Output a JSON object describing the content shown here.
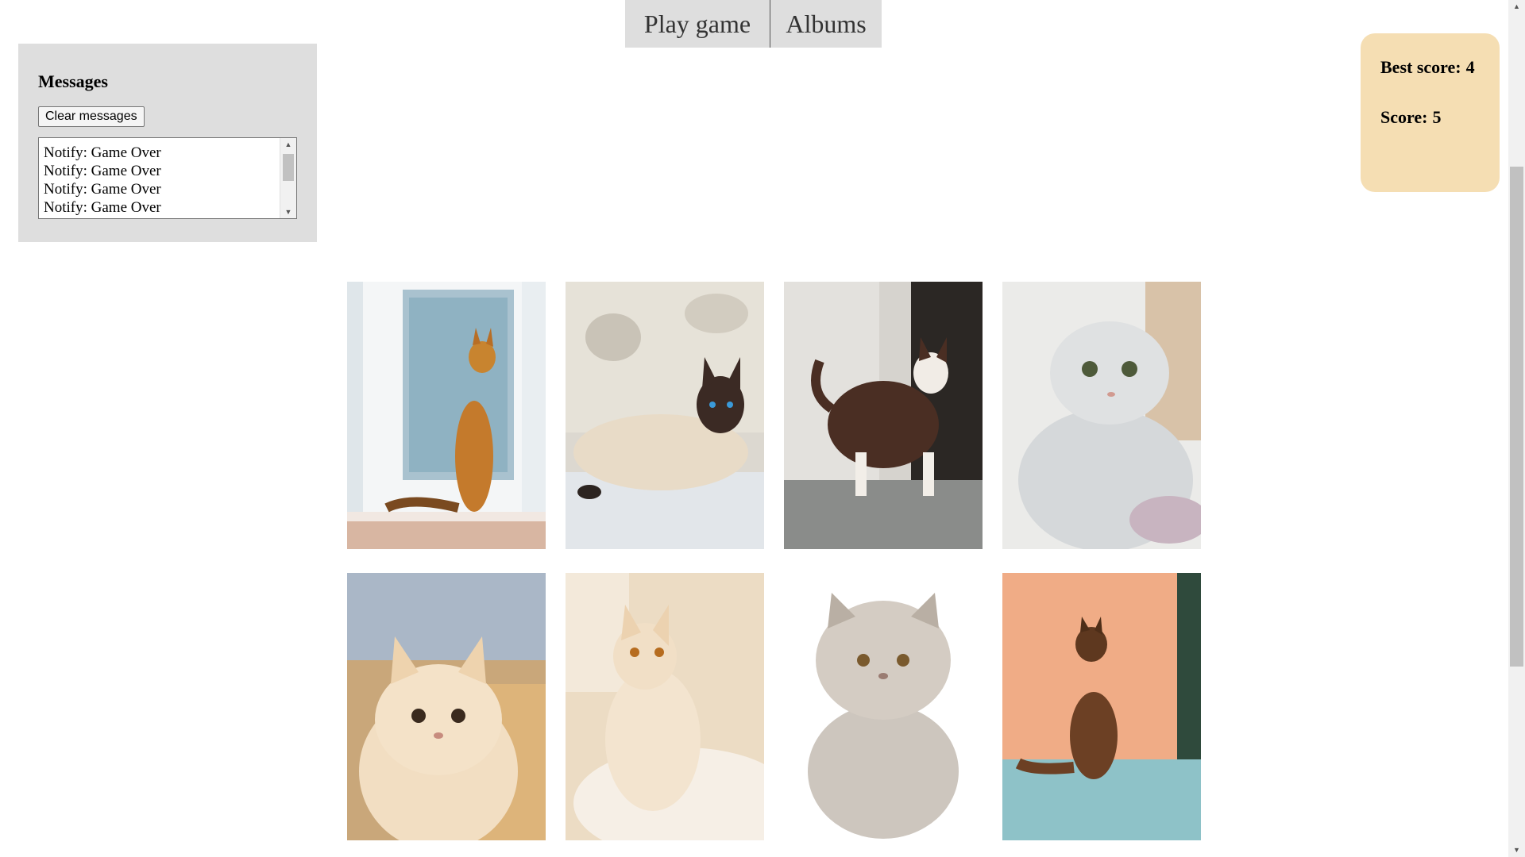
{
  "nav": {
    "play_label": "Play game",
    "albums_label": "Albums"
  },
  "messages": {
    "title": "Messages",
    "clear_label": "Clear messages",
    "items": [
      "Notify: Game Over",
      "Notify: Game Over",
      "Notify: Game Over",
      "Notify: Game Over"
    ]
  },
  "score": {
    "best_label": "Best score:",
    "best_value": "4",
    "current_label": "Score:",
    "current_value": "5"
  },
  "cards": [
    {
      "subject": "orange-somali-cat-at-window",
      "bg": "#b9cbd6",
      "body": "#c27a2e"
    },
    {
      "subject": "siamese-cat-lying",
      "bg": "#d9d6cf",
      "body": "#e4d8c8"
    },
    {
      "subject": "snowshoe-brown-white-cat",
      "bg": "#cfcac3",
      "body": "#4a2e23"
    },
    {
      "subject": "silver-scottish-fold-cat",
      "bg": "#eaeae8",
      "body": "#cfd2d4"
    },
    {
      "subject": "cream-exotic-shorthair-cat",
      "bg": "#d9b585",
      "body": "#f0d9b8"
    },
    {
      "subject": "cream-angora-cat",
      "bg": "#ead4b0",
      "body": "#f4e7d4"
    },
    {
      "subject": "grey-persian-kitten",
      "bg": "#ffffff",
      "body": "#c8c0b8"
    },
    {
      "subject": "brown-long-hair-cat-orange-wall",
      "bg": "#f0b088",
      "body": "#6c4024"
    }
  ],
  "colors": {
    "panel_gray": "#dedede",
    "score_bg": "#f5deb3"
  }
}
